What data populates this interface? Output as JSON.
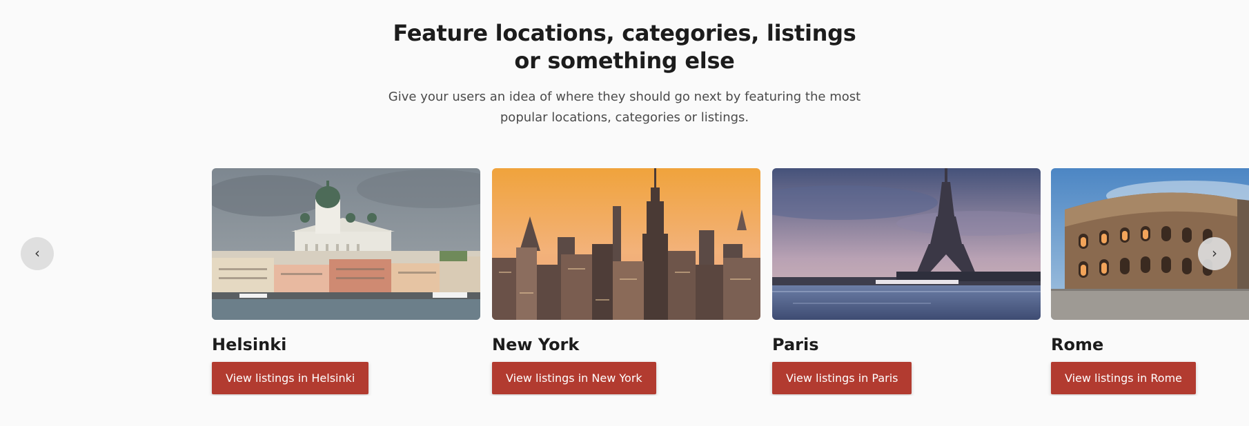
{
  "section": {
    "title_line1": "Feature locations, categories, listings",
    "title_line2": "or something else",
    "subtitle": "Give your users an idea of where they should go next by featuring the most popular locations, categories or listings."
  },
  "carousel": {
    "prev_label": "‹",
    "next_label": "›",
    "cards": [
      {
        "city": "Helsinki",
        "button": "View listings in Helsinki",
        "image": "helsinki-cathedral-harbor-photo"
      },
      {
        "city": "New York",
        "button": "View listings in New York",
        "image": "new-york-skyline-sunset-photo"
      },
      {
        "city": "Paris",
        "button": "View listings in Paris",
        "image": "paris-eiffel-tower-river-photo"
      },
      {
        "city": "Rome",
        "button": "View listings in Rome",
        "image": "rome-colosseum-photo"
      }
    ]
  },
  "colors": {
    "button_bg": "#b23b30",
    "page_bg": "#fafafa",
    "text": "#1c1c1c"
  }
}
